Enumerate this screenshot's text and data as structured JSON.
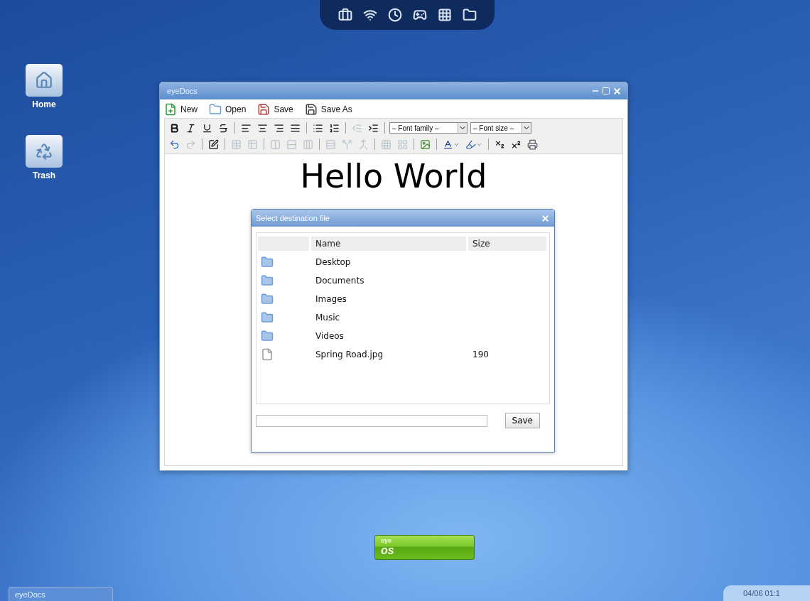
{
  "desktop_icons": [
    {
      "label": "Home",
      "kind": "home"
    },
    {
      "label": "Trash",
      "kind": "trash"
    }
  ],
  "window": {
    "title": "eyeDocs",
    "file_actions": [
      {
        "label": "New",
        "kind": "new"
      },
      {
        "label": "Open",
        "kind": "open"
      },
      {
        "label": "Save",
        "kind": "save"
      },
      {
        "label": "Save As",
        "kind": "saveas"
      }
    ],
    "format_tools": [
      {
        "disabled": false
      },
      {
        "disabled": false
      },
      {
        "disabled": false
      },
      {
        "disabled": false
      },
      {
        "disabled": false
      },
      {
        "disabled": false
      },
      {
        "disabled": false
      },
      {
        "disabled": false
      },
      {
        "disabled": false
      },
      {
        "disabled": false
      },
      {
        "disabled": true
      },
      {
        "disabled": false
      }
    ],
    "font_family": {
      "value": "– Font family –"
    },
    "font_size": {
      "value": "– Font size –"
    },
    "insert_tools": [
      {
        "disabled": false
      },
      {
        "disabled": true
      },
      {
        "disabled": false
      },
      {
        "disabled": true
      },
      {
        "disabled": true
      },
      {
        "disabled": true
      },
      {
        "disabled": true
      },
      {
        "disabled": true
      },
      {
        "disabled": true
      },
      {
        "disabled": true
      },
      {
        "disabled": true
      },
      {
        "disabled": true
      },
      {
        "disabled": true
      },
      {
        "disabled": false
      },
      {
        "disabled": false
      },
      {
        "disabled": false
      },
      {
        "disabled": false
      },
      {
        "disabled": false
      },
      {
        "disabled": false
      }
    ],
    "document_text": "Hello World"
  },
  "dialog": {
    "title": "Select destination file",
    "columns": [
      "Name",
      "Size"
    ],
    "rows": [
      {
        "kind": "folder",
        "name": "Desktop"
      },
      {
        "kind": "folder",
        "name": "Documents"
      },
      {
        "kind": "folder",
        "name": "Images"
      },
      {
        "kind": "folder",
        "name": "Music"
      },
      {
        "kind": "folder",
        "name": "Videos"
      },
      {
        "kind": "file",
        "name": "Spring Road.jpg",
        "size": "190"
      }
    ],
    "save_button": "Save"
  },
  "launcher": {
    "top": "eye",
    "bottom": "os"
  },
  "taskbar": {
    "tasks": [
      {
        "label": "eyeDocs"
      }
    ],
    "clock": "04/06 01:1"
  }
}
